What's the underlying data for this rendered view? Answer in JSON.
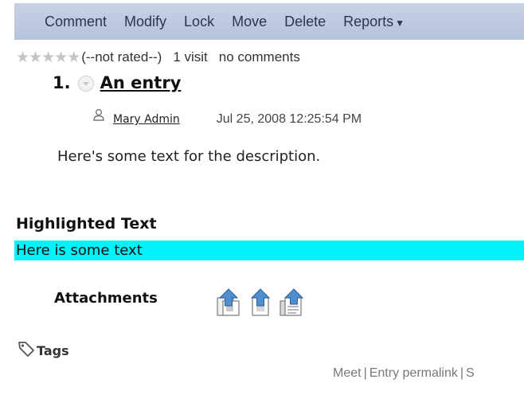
{
  "toolbar": {
    "items": [
      {
        "label": "Comment"
      },
      {
        "label": "Modify"
      },
      {
        "label": "Lock"
      },
      {
        "label": "Move"
      },
      {
        "label": "Delete"
      },
      {
        "label": "Reports",
        "icon": "chevron-down-icon"
      }
    ]
  },
  "rating": {
    "stars_filled": 0,
    "stars_total": 5,
    "status": "(--not rated--)",
    "visits": "1 visit",
    "comments": "no comments"
  },
  "entry": {
    "number": "1.",
    "title": "An entry",
    "author": "Mary Admin",
    "timestamp": "Jul 25, 2008 12:25:54 PM",
    "description": "Here's some text for the description."
  },
  "highlighted": {
    "heading": "Highlighted Text",
    "text": "Here is some text"
  },
  "attachments": {
    "label": "Attachments",
    "items": [
      {
        "icon": "upload-image-file-icon"
      },
      {
        "icon": "upload-file-icon"
      },
      {
        "icon": "upload-document-icon"
      }
    ]
  },
  "tags": {
    "label": "Tags"
  },
  "footer": {
    "links": [
      "Meet",
      "Entry permalink",
      "S"
    ]
  },
  "colors": {
    "toolbar_bg": "#bcc7de",
    "highlight_bg": "#00f3f8",
    "footer_text": "#777777",
    "star_empty": "#c4c4c4"
  }
}
